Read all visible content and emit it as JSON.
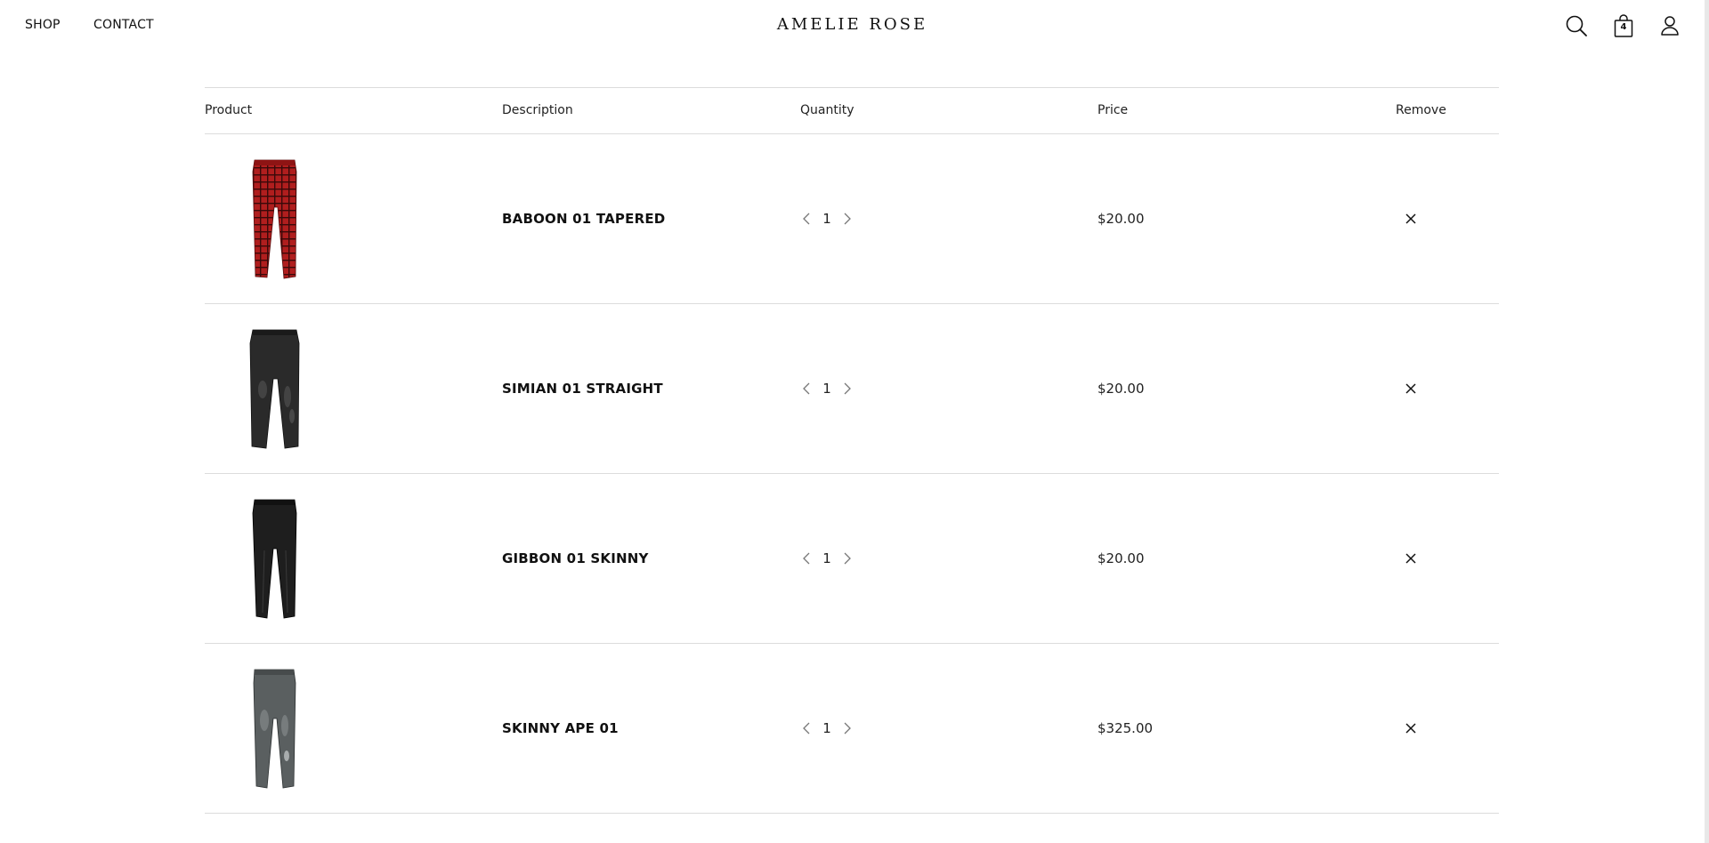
{
  "header": {
    "nav": {
      "shop": "SHOP",
      "contact": "CONTACT"
    },
    "brand": "AMELIE ROSE",
    "icons": {
      "search": "search-icon",
      "cart": "shopping-bag-icon",
      "account": "user-icon"
    },
    "cart_count": "4"
  },
  "table": {
    "headers": {
      "product": "Product",
      "description": "Description",
      "quantity": "Quantity",
      "price": "Price",
      "remove": "Remove"
    },
    "rows": [
      {
        "name": "BABOON 01 TAPERED",
        "quantity": "1",
        "price": "$20.00",
        "image": "red-plaid-jeans"
      },
      {
        "name": "SIMIAN 01 STRAIGHT",
        "quantity": "1",
        "price": "$20.00",
        "image": "black-distressed-jeans"
      },
      {
        "name": "GIBBON 01 SKINNY",
        "quantity": "1",
        "price": "$20.00",
        "image": "black-skinny-jeans"
      },
      {
        "name": "SKINNY APE 01",
        "quantity": "1",
        "price": "$325.00",
        "image": "grey-distressed-jeans"
      }
    ]
  },
  "colors": {
    "text": "#111111",
    "divider": "#dcdcdc",
    "plaid_red": "#b01e1e",
    "black_denim": "#2a2a2a",
    "grey_denim": "#5a5f60"
  }
}
